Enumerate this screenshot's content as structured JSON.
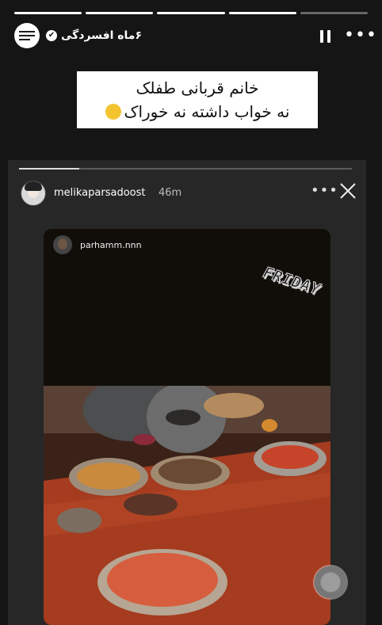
{
  "progress": {
    "segments": 5,
    "filled": 4,
    "current_fraction": 1
  },
  "story": {
    "username": "۶ماه افسردگی",
    "verified": true
  },
  "caption": {
    "line1": "خانم قربانی طفلک",
    "line2": "نه خواب داشته نه خوراک"
  },
  "inner_story": {
    "username": "melikaparsadoost",
    "time": "46m",
    "progress_fraction": 0.18,
    "nested_post": {
      "username": "parhamm.nnn",
      "sticker_text": "FRIDAY"
    }
  },
  "icons": {
    "verified": "verified-badge-icon",
    "pause": "pause-icon",
    "more": "more-options-icon",
    "close": "close-icon",
    "emoji": "laughing-tears-emoji-icon",
    "capture": "capture-button-icon"
  },
  "colors": {
    "background": "#151515",
    "caption_bg": "#ffffff",
    "table": "#a53b1f"
  }
}
